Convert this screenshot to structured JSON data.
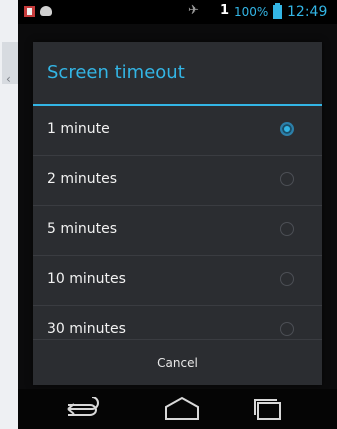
{
  "status_bar": {
    "signal_count": "1",
    "battery_percent": "100%",
    "time": "12:49"
  },
  "dialog": {
    "title": "Screen timeout",
    "options": [
      {
        "label": "1 minute",
        "selected": true
      },
      {
        "label": "2 minutes",
        "selected": false
      },
      {
        "label": "5 minutes",
        "selected": false
      },
      {
        "label": "10 minutes",
        "selected": false
      },
      {
        "label": "30 minutes",
        "selected": false
      }
    ],
    "cancel_label": "Cancel"
  },
  "nav_bar": {
    "back_icon": "back-icon",
    "home_icon": "home-icon",
    "recent_icon": "recent-apps-icon"
  },
  "colors": {
    "accent": "#33b5e5",
    "dialog_bg": "#2b2d31"
  }
}
